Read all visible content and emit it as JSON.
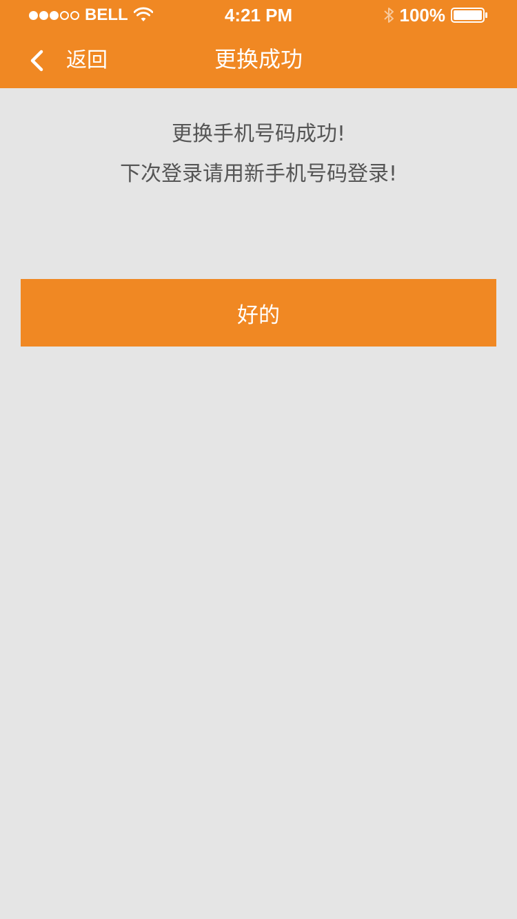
{
  "status_bar": {
    "carrier": "BELL",
    "signal_bars_filled": 3,
    "signal_bars_total": 5,
    "time": "4:21 PM",
    "battery": "100%",
    "icons": [
      "wifi-icon",
      "bluetooth-icon",
      "battery-icon"
    ]
  },
  "nav": {
    "back_label": "返回",
    "title": "更换成功",
    "back_icon": "chevron-left-icon"
  },
  "message": {
    "line1": "更换手机号码成功!",
    "line2": "下次登录请用新手机号码登录!"
  },
  "confirm_button": {
    "label": "好的"
  },
  "colors": {
    "accent": "#f08823",
    "background": "#e5e5e5",
    "message_text": "#555555",
    "header_text": "#ffffff"
  }
}
